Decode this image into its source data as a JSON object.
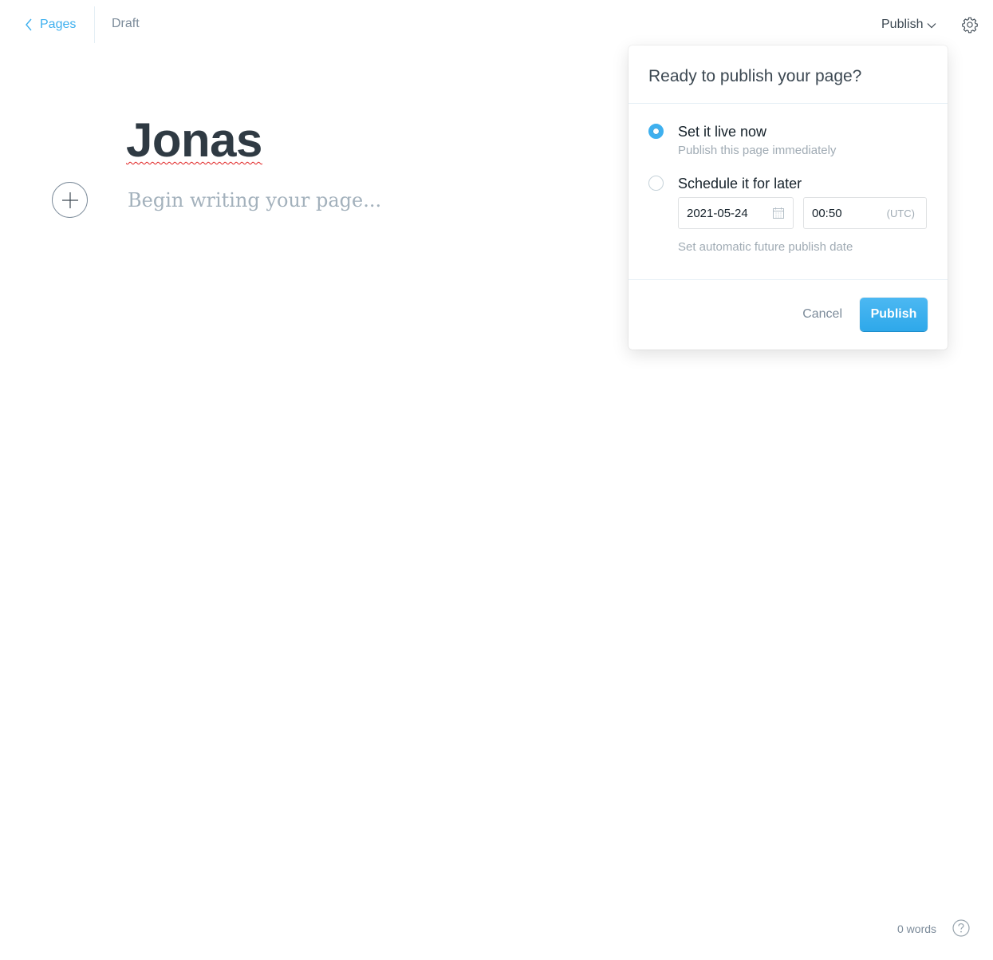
{
  "header": {
    "back_label": "Pages",
    "status": "Draft",
    "publish_menu_label": "Publish"
  },
  "editor": {
    "title": "Jonas",
    "body_placeholder": "Begin writing your page..."
  },
  "publish_popover": {
    "heading": "Ready to publish your page?",
    "options": [
      {
        "label": "Set it live now",
        "hint": "Publish this page immediately",
        "selected": true
      },
      {
        "label": "Schedule it for later",
        "selected": false
      }
    ],
    "schedule": {
      "date": "2021-05-24",
      "time": "00:50",
      "timezone": "(UTC)",
      "hint": "Set automatic future publish date"
    },
    "cancel_label": "Cancel",
    "publish_label": "Publish"
  },
  "footer": {
    "word_count": "0 words"
  },
  "colors": {
    "accent": "#3eb0ef",
    "text": "#15212a",
    "muted": "#7c8b9a",
    "spellcheck": "#e02020"
  },
  "icons": [
    "chevron-left-icon",
    "chevron-down-icon",
    "gear-icon",
    "plus-icon",
    "calendar-icon",
    "help-icon"
  ]
}
